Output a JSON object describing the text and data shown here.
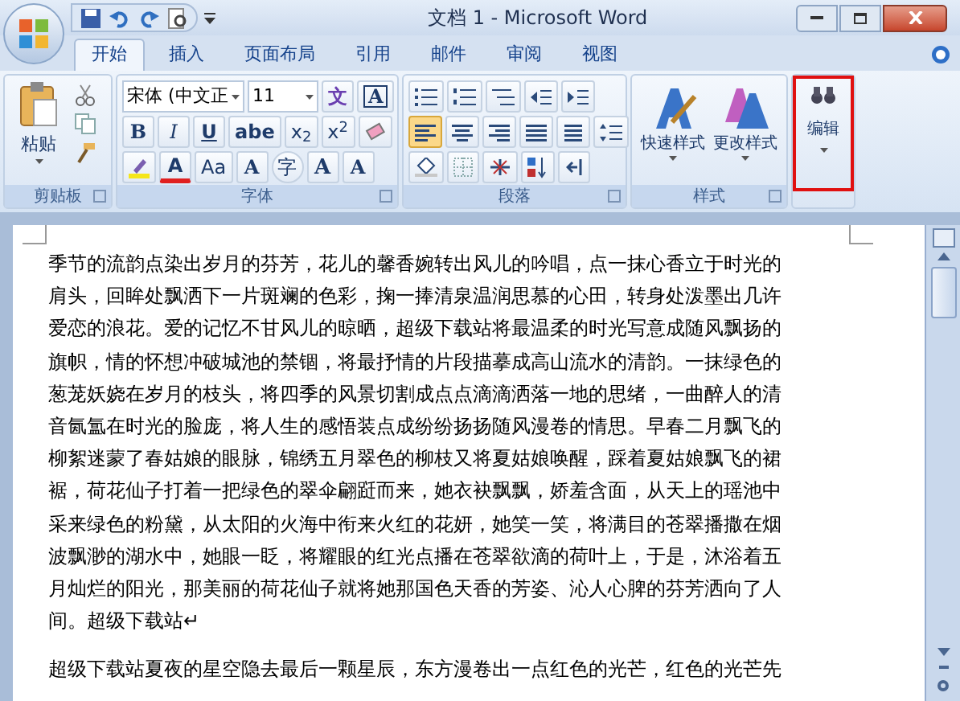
{
  "window": {
    "title": "文档 1 - Microsoft Word"
  },
  "tabs": [
    {
      "label": "开始",
      "selected": true
    },
    {
      "label": "插入",
      "selected": false
    },
    {
      "label": "页面布局",
      "selected": false
    },
    {
      "label": "引用",
      "selected": false
    },
    {
      "label": "邮件",
      "selected": false
    },
    {
      "label": "审阅",
      "selected": false
    },
    {
      "label": "视图",
      "selected": false
    }
  ],
  "clipboard": {
    "paste_label": "粘贴",
    "group_label": "剪贴板"
  },
  "font": {
    "font_name": "宋体 (中文正",
    "font_size": "11",
    "phonetic": "文",
    "border": "A",
    "group_label": "字体",
    "row_1": [
      {
        "kind": "bold",
        "label": "B"
      },
      {
        "kind": "italic",
        "label": "I"
      },
      {
        "kind": "underline",
        "label": "U"
      },
      {
        "kind": "strike",
        "label": "abe"
      },
      {
        "kind": "sub",
        "label": "x$_{2}$"
      },
      {
        "kind": "sup",
        "label": "x$^{2}$"
      }
    ],
    "row_2": [
      {
        "kind": "color",
        "label": "A"
      },
      {
        "kind": "case",
        "label": "Aa"
      },
      {
        "kind": "shade",
        "label": "A"
      },
      {
        "kind": "enclose",
        "label": "字"
      },
      {
        "kind": "grow",
        "label": "A"
      },
      {
        "kind": "shrink",
        "label": "A"
      }
    ]
  },
  "paragraph": {
    "group_label": "段落",
    "alignment": [
      {
        "selected": true
      },
      {
        "selected": false
      },
      {
        "selected": false
      },
      {
        "selected": false
      },
      {
        "selected": false
      }
    ]
  },
  "styles": {
    "group_label": "样式",
    "buttons": [
      {
        "label": "快速样式"
      },
      {
        "label": "更改样式"
      }
    ]
  },
  "editing": {
    "label": "编辑",
    "highlighted": true
  },
  "document": {
    "paragraphs": [
      {
        "lines": [
          "季节的流韵点染出岁月的芬芳，花儿的馨香婉转出风儿的吟唱，点一抹心香立于时光的",
          "肩头，回眸处飘洒下一片斑斓的色彩，掬一捧清泉温润思慕的心田，转身处泼墨出几许",
          "爱恋的浪花。爱的记忆不甘风儿的晾晒，超级下载站将最温柔的时光写意成随风飘扬的",
          "旗帜，情的怀想冲破城池的禁锢，将最抒情的片段描摹成高山流水的清韵。一抹绿色的",
          "葱茏妖娆在岁月的枝头，将四季的风景切割成点点滴滴洒落一地的思绪，一曲醉人的清",
          "音氤氲在时光的脸庞，将人生的感悟装点成纷纷扬扬随风漫卷的情思。早春二月飘飞的",
          "柳絮迷蒙了春姑娘的眼脉，锦绣五月翠色的柳枝又将夏姑娘唤醒，踩着夏姑娘飘飞的裙",
          "裾，荷花仙子打着一把绿色的翠伞翩跹而来，她衣袂飘飘，娇羞含面，从天上的瑶池中",
          "采来绿色的粉黛，从太阳的火海中衔来火红的花妍，她笑一笑，将满目的苍翠播撒在烟",
          "波飘渺的湖水中，她眼一眨，将耀眼的红光点播在苍翠欲滴的荷叶上，于是，沐浴着五",
          "月灿烂的阳光，那美丽的荷花仙子就将她那国色天香的芳姿、沁人心脾的芬芳洒向了人",
          "间。超级下载站↵"
        ]
      },
      {
        "lines": [
          "超级下载站夏夜的星空隐去最后一颗星辰，东方漫卷出一点红色的光芒，红色的光芒先"
        ]
      }
    ]
  }
}
